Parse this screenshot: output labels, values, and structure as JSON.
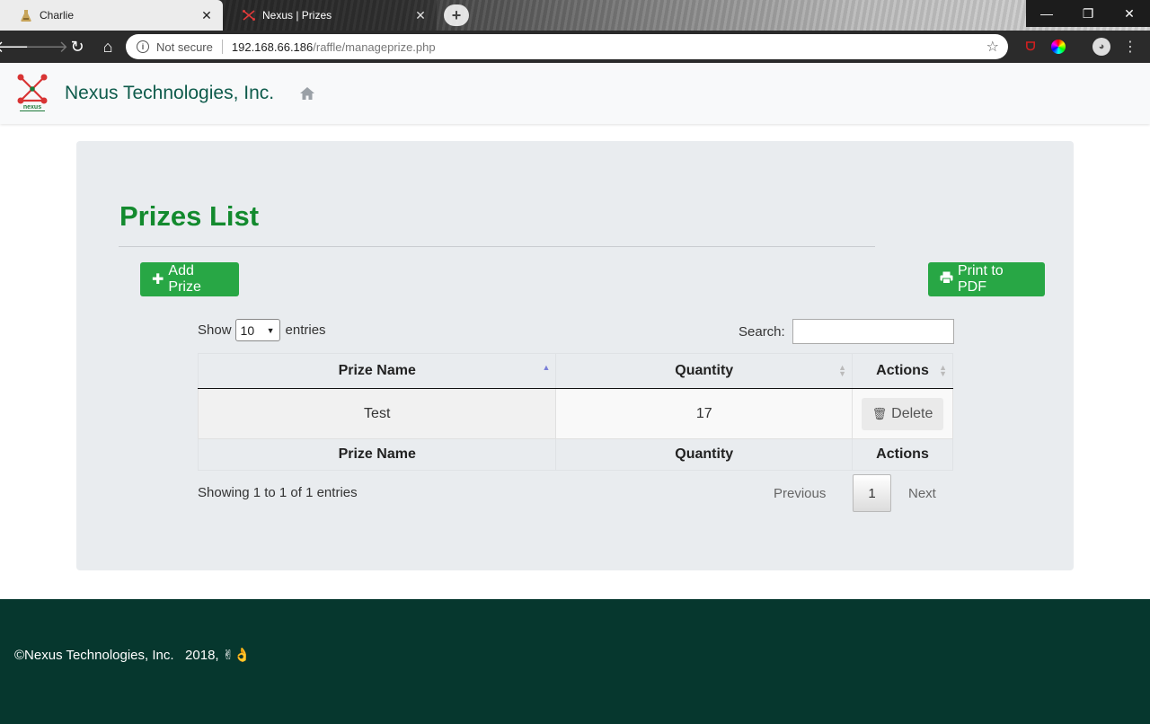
{
  "browser": {
    "tabs": [
      {
        "title": "Charlie",
        "active": true
      },
      {
        "title": "Nexus | Prizes",
        "active": false
      }
    ],
    "security_label": "Not secure",
    "url_host": "192.168.66.186",
    "url_path": "/raffle/manageprize.php"
  },
  "navbar": {
    "brand_name": "Nexus Technologies, Inc.",
    "logo_text": "nexus"
  },
  "main": {
    "title": "Prizes List",
    "add_button_label": "Add Prize",
    "print_button_label": "Print to PDF",
    "length": {
      "show_label": "Show",
      "value": "10",
      "entries_label": "entries"
    },
    "search_label": "Search:",
    "table": {
      "columns": [
        "Prize Name",
        "Quantity",
        "Actions"
      ],
      "rows": [
        {
          "name": "Test",
          "quantity": "17",
          "action": "Delete"
        }
      ]
    },
    "info": "Showing 1 to 1 of 1 entries",
    "pagination": {
      "previous": "Previous",
      "page": "1",
      "next": "Next"
    }
  },
  "footer": {
    "text": "©Nexus Technologies, Inc.   2018, ✌👌"
  },
  "colors": {
    "brand_green": "#138a2e",
    "button_green": "#28a745",
    "footer_bg": "#06372e",
    "brand_text": "#0e5b4b"
  }
}
